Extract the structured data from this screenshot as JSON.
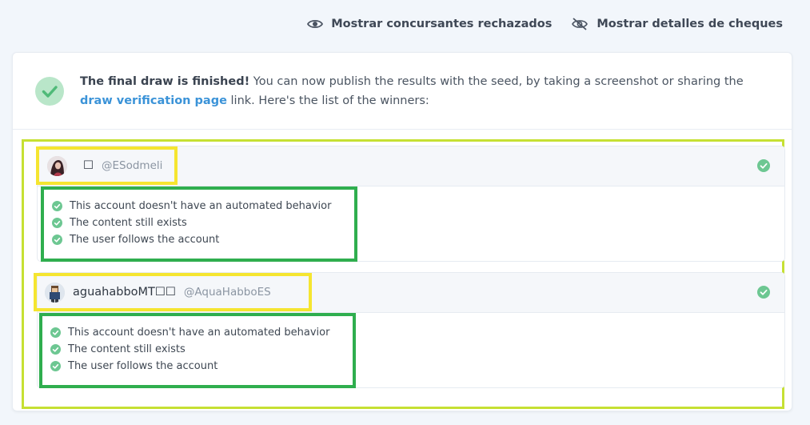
{
  "toolbar": {
    "show_rejected_label": "Mostrar concursantes rechazados",
    "show_check_details_label": "Mostrar detalles de cheques"
  },
  "banner": {
    "bold_text": "The final draw is finished!",
    "text_before_link": " You can now publish the results with the seed, by taking a screenshot or sharing the ",
    "link_text": "draw verification page",
    "text_after_link": " link. Here's the list of the winners:"
  },
  "winners": [
    {
      "name": "",
      "handle": "@ESodmeli",
      "checks": [
        "This account doesn't have an automated behavior",
        "The content still exists",
        "The user follows the account"
      ]
    },
    {
      "name": "aguahabboMT☐☐",
      "handle": "@AquaHabboES",
      "checks": [
        "This account doesn't have an automated behavior",
        "The content still exists",
        "The user follows the account"
      ]
    }
  ],
  "colors": {
    "success_green": "#6dc792",
    "link_blue": "#3b93d8",
    "frame_lime": "#c6e033",
    "highlight_yellow": "#f5e530",
    "highlight_green": "#2fae4e"
  }
}
